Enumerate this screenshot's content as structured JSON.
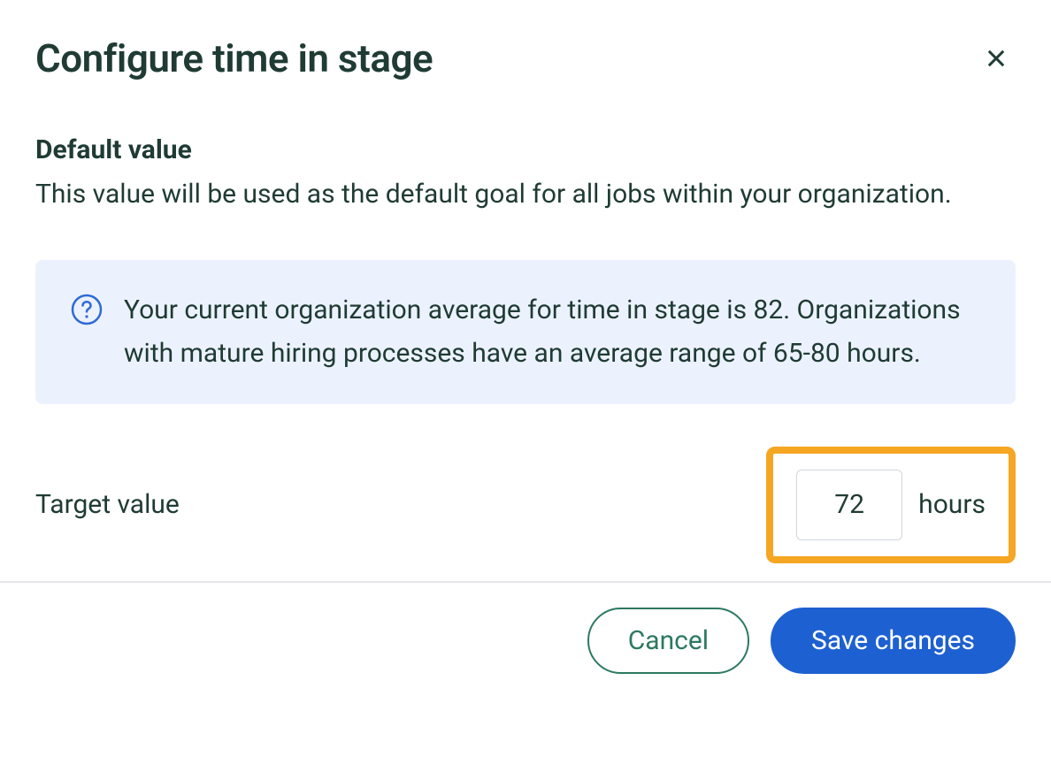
{
  "modal": {
    "title": "Configure time in stage",
    "close_label": "Close"
  },
  "section": {
    "title": "Default value",
    "description": "This value will be used as the default goal for all jobs within your organization."
  },
  "info": {
    "text": "Your current organization average for time in stage is 82. Organizations with mature hiring processes have an average range of 65-80 hours.",
    "current_average": 82,
    "benchmark_range": "65-80"
  },
  "target": {
    "label": "Target value",
    "value": "72",
    "unit": "hours"
  },
  "footer": {
    "cancel_label": "Cancel",
    "save_label": "Save changes"
  }
}
